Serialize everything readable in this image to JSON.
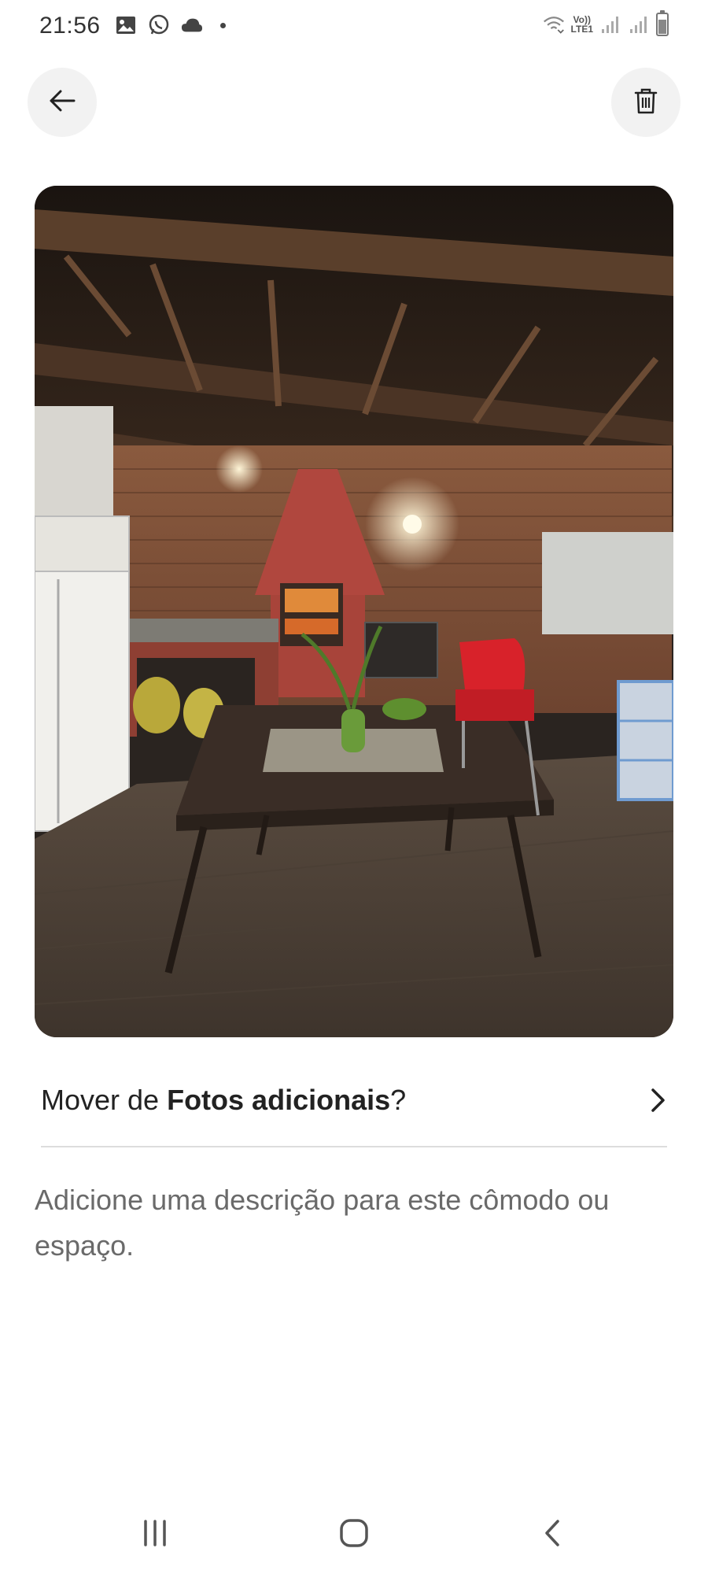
{
  "status_bar": {
    "time": "21:56",
    "left_icons": [
      "gallery-icon",
      "whatsapp-icon",
      "cloud-icon",
      "notification-dot"
    ],
    "right_icons": [
      "wifi-calling-icon",
      "volte-lte-icon",
      "signal-icon",
      "signal-icon",
      "battery-icon"
    ],
    "volte_label": "Vo))",
    "lte_label": "LTE1"
  },
  "header": {
    "back_icon": "arrow-left-icon",
    "delete_icon": "trash-icon"
  },
  "photo": {
    "subject": "outdoor-kitchen-photo"
  },
  "move": {
    "prefix": "Mover de ",
    "section": "Fotos adicionais",
    "suffix": "?",
    "icon": "chevron-right-icon"
  },
  "description": {
    "placeholder": "Adicione uma descrição para este cômodo ou espaço."
  },
  "nav": {
    "recents_icon": "recents-icon",
    "home_icon": "home-icon",
    "back_icon": "back-chevron-icon"
  },
  "colors": {
    "accent_text": "#222222",
    "muted_text": "#6a6a6a",
    "button_bg": "#f2f2f2",
    "divider": "#dddddd"
  }
}
